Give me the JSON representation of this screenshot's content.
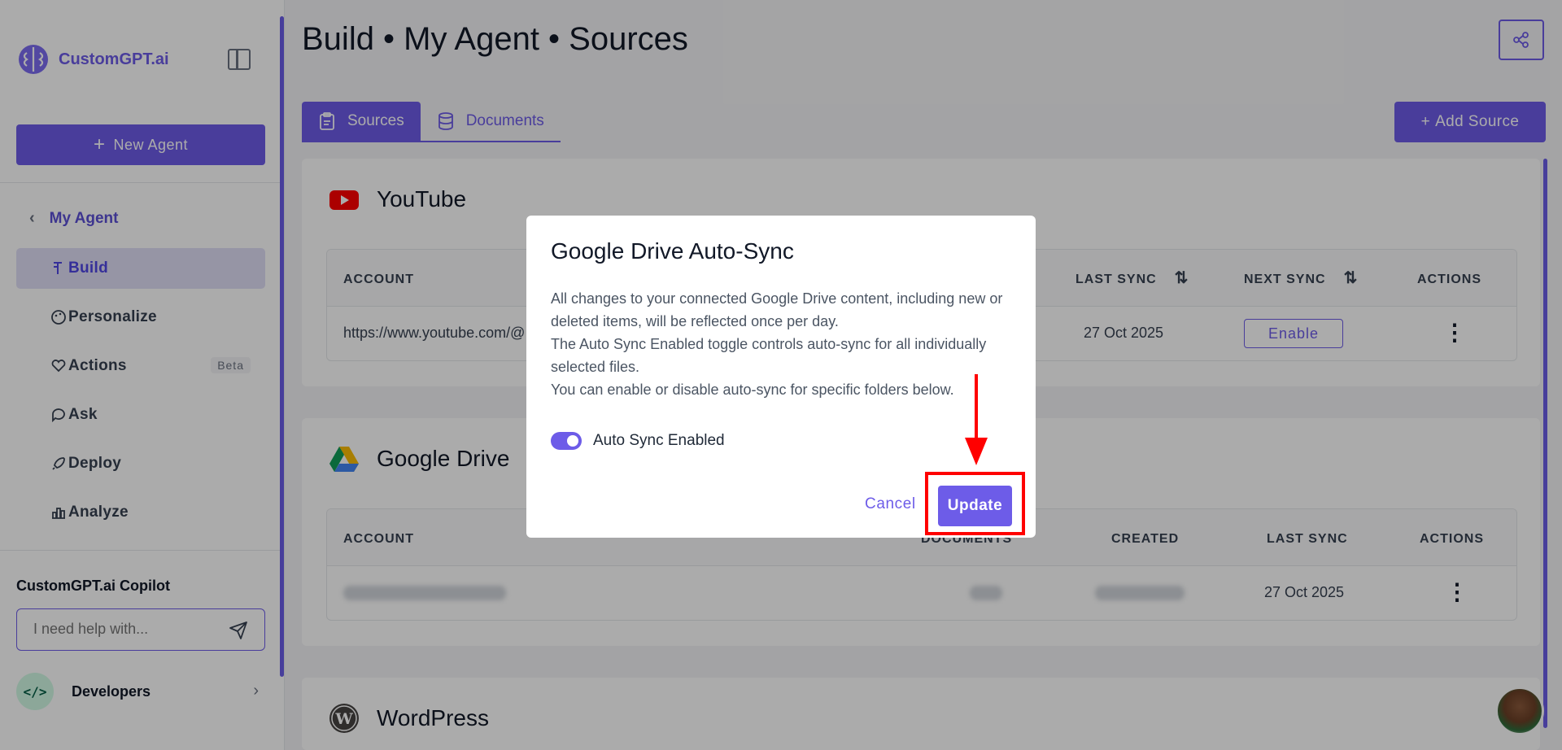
{
  "brand": {
    "name": "CustomGPT.ai"
  },
  "sidebar": {
    "new_agent_label": "New Agent",
    "back_label": "My Agent",
    "items": [
      {
        "label": "Build",
        "icon": "build-icon",
        "active": true
      },
      {
        "label": "Personalize",
        "icon": "palette-icon"
      },
      {
        "label": "Actions",
        "icon": "heart-hand-icon",
        "badge": "Beta"
      },
      {
        "label": "Ask",
        "icon": "chat-icon"
      },
      {
        "label": "Deploy",
        "icon": "rocket-icon"
      },
      {
        "label": "Analyze",
        "icon": "bar-chart-icon"
      }
    ],
    "copilot_title": "CustomGPT.ai Copilot",
    "copilot_placeholder": "I need help with...",
    "developers_label": "Developers"
  },
  "header": {
    "title": "Build • My Agent • Sources"
  },
  "tabs": [
    {
      "label": "Sources",
      "active": true
    },
    {
      "label": "Documents",
      "active": false
    }
  ],
  "add_source_label": "Add Source",
  "youtube": {
    "title": "YouTube",
    "columns": [
      "ACCOUNT",
      "LAST SYNC",
      "NEXT SYNC",
      "ACTIONS"
    ],
    "row": {
      "account": "https://www.youtube.com/@",
      "last_sync": "27 Oct 2025",
      "next_sync_button": "Enable"
    }
  },
  "gdrive": {
    "title": "Google Drive",
    "columns": [
      "ACCOUNT",
      "DOCUMENTS",
      "CREATED",
      "LAST SYNC",
      "ACTIONS"
    ],
    "row": {
      "last_sync": "27 Oct 2025"
    }
  },
  "wordpress": {
    "title": "WordPress"
  },
  "modal": {
    "title": "Google Drive Auto-Sync",
    "body_lines": [
      "All changes to your connected Google Drive content, including new or deleted items, will be reflected once per day.",
      "The Auto Sync Enabled toggle controls auto-sync for all individually selected files.",
      "You can enable or disable auto-sync for specific folders below."
    ],
    "toggle_label": "Auto Sync Enabled",
    "toggle_on": true,
    "cancel_label": "Cancel",
    "update_label": "Update"
  },
  "colors": {
    "accent": "#6d5ce8",
    "highlight": "#ff0000"
  }
}
